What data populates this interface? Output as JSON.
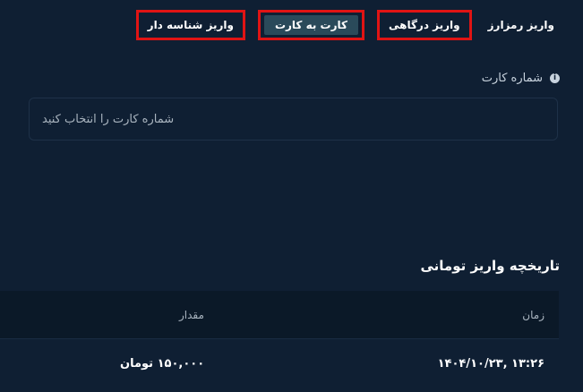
{
  "tabs": [
    {
      "label": "واریز رمزارز",
      "state": "plain"
    },
    {
      "label": "واریز درگاهی",
      "state": "outlined"
    },
    {
      "label": "کارت به کارت",
      "state": "active"
    },
    {
      "label": "واریز شناسه دار",
      "state": "outlined"
    }
  ],
  "card_field": {
    "label": "شماره کارت",
    "info_icon": "i",
    "placeholder": "شماره کارت را انتخاب کنید"
  },
  "history": {
    "title": "تاریخچه واریز تومانی",
    "columns": {
      "time": "زمان",
      "amount": "مقدار"
    },
    "rows": [
      {
        "time": "۱۴۰۴/۱۰/۲۳, ۱۳:۲۶",
        "amount": "۱۵۰,۰۰۰ تومان"
      }
    ]
  },
  "colors": {
    "background": "#0f1f33",
    "highlight_border": "#e01414",
    "active_tab": "#2a4a5a",
    "table_header": "#0b1928"
  }
}
